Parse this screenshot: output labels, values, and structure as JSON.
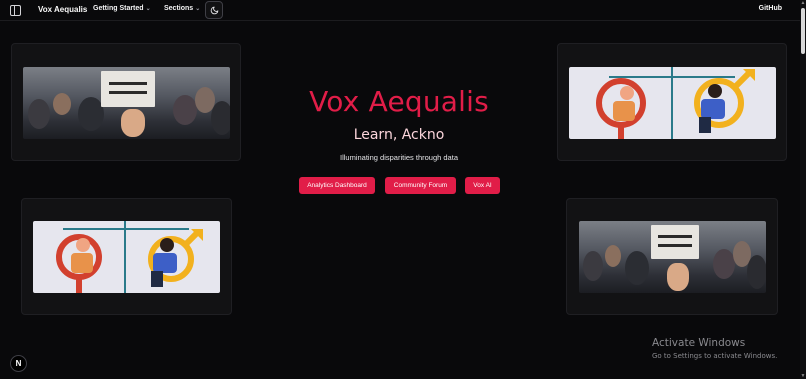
{
  "nav": {
    "brand": "Vox Aequalis",
    "menu": [
      {
        "label": "Getting Started"
      },
      {
        "label": "Sections"
      }
    ],
    "github": "GitHub",
    "icons": {
      "sidebar": "sidebar-toggle-icon",
      "theme": "moon-icon",
      "chevron": "chevron-down-icon"
    }
  },
  "hero": {
    "title": "Vox Aequalis",
    "subtitle": "Learn, Ackno",
    "tagline": "Illuminating disparities through data",
    "buttons": [
      {
        "label": "Analytics Dashboard"
      },
      {
        "label": "Community Forum"
      },
      {
        "label": "Vox AI"
      }
    ]
  },
  "colors": {
    "accent": "#e11d48",
    "background": "#09090b",
    "card": "#121214"
  },
  "windows": {
    "activate_title": "Activate Windows",
    "activate_sub": "Go to Settings to activate Windows."
  },
  "badge": "N"
}
